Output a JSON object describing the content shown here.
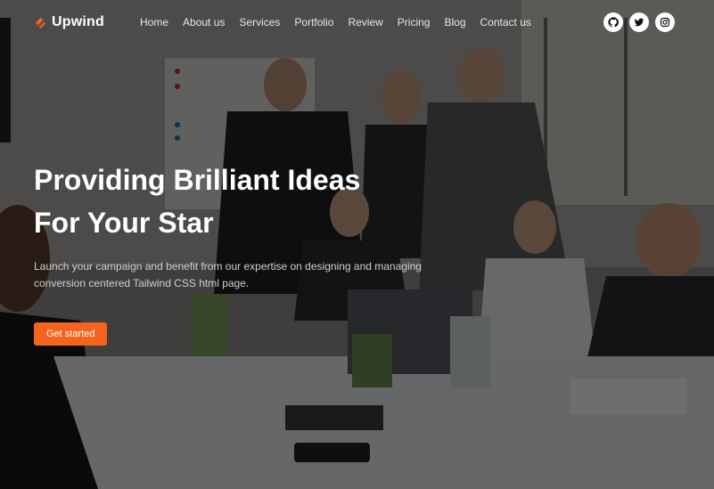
{
  "brand": {
    "name": "Upwind",
    "accent": "#f4641e"
  },
  "nav": {
    "items": [
      "Home",
      "About us",
      "Services",
      "Portfolio",
      "Review",
      "Pricing",
      "Blog",
      "Contact us"
    ]
  },
  "socials": [
    {
      "icon": "github-icon"
    },
    {
      "icon": "twitter-icon"
    },
    {
      "icon": "instagram-icon"
    }
  ],
  "hero": {
    "title_line1": "Providing Brilliant Ideas",
    "title_line2": "For Your Star",
    "description": "Launch your campaign and benefit from our expertise on designing and managing conversion centered Tailwind CSS html page.",
    "cta": "Get started"
  }
}
